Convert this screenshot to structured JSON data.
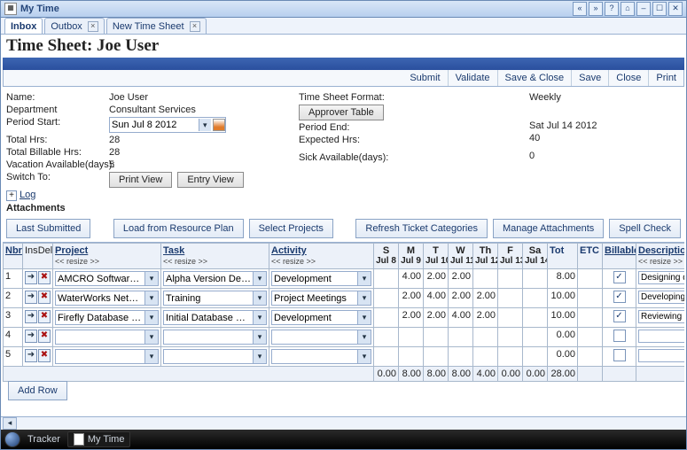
{
  "window": {
    "title": "My Time"
  },
  "winbuttons": [
    "«",
    "»",
    "?",
    "⌂",
    "–",
    "☐",
    "✕"
  ],
  "tabs": [
    {
      "label": "Inbox",
      "closable": false,
      "active": true
    },
    {
      "label": "Outbox",
      "closable": true,
      "active": false
    },
    {
      "label": "New Time Sheet",
      "closable": true,
      "active": false
    }
  ],
  "page_title": "Time Sheet: Joe User",
  "actions": [
    "Submit",
    "Validate",
    "Save & Close",
    "Save",
    "Close",
    "Print"
  ],
  "info": {
    "left": {
      "name_lbl": "Name:",
      "name_val": "Joe User",
      "dept_lbl": "Department",
      "dept_val": "Consultant Services",
      "pstart_lbl": "Period Start:",
      "pstart_val": "Sun Jul 8 2012",
      "thrs_lbl": "Total Hrs:",
      "thrs_val": "28",
      "tbhrs_lbl": "Total Billable Hrs:",
      "tbhrs_val": "28",
      "vac_lbl": "Vacation Available(days):",
      "vac_val": "5",
      "switch_lbl": "Switch To:",
      "log": "Log",
      "print_view": "Print View",
      "entry_view": "Entry View"
    },
    "mid": {
      "fmt_lbl": "Time Sheet Format:",
      "approver_btn": "Approver Table",
      "pend_lbl": "Period End:",
      "pend_val": "Sat Jul 14 2012",
      "exp_lbl": "Expected Hrs:",
      "exp_val": "40",
      "sick_lbl": "Sick Available(days):",
      "sick_val": "0"
    },
    "right": {
      "weekly": "Weekly"
    },
    "attachments": "Attachments"
  },
  "toolbar": [
    "Last Submitted",
    "Load from Resource Plan",
    "Select Projects",
    "Refresh Ticket Categories",
    "Manage Attachments",
    "Spell Check"
  ],
  "grid": {
    "nbr": "Nbr",
    "ins": "Ins",
    "del": "Del",
    "resize": "<< resize >>",
    "proj": "Project",
    "task": "Task",
    "act": "Activity",
    "days": [
      {
        "d": "S",
        "n": "Jul 8"
      },
      {
        "d": "M",
        "n": "Jul 9"
      },
      {
        "d": "T",
        "n": "Jul 10"
      },
      {
        "d": "W",
        "n": "Jul 11"
      },
      {
        "d": "Th",
        "n": "Jul 12"
      },
      {
        "d": "F",
        "n": "Jul 13"
      },
      {
        "d": "Sa",
        "n": "Jul 14"
      }
    ],
    "tot": "Tot",
    "etc": "ETC",
    "bill": "Billable",
    "desc": "Description"
  },
  "rows": [
    {
      "n": "1",
      "project": "AMCRO Software Project",
      "task": "Alpha Version Developme",
      "activity": "Development",
      "cells": [
        "",
        "4.00",
        "2.00",
        "2.00",
        "",
        "",
        ""
      ],
      "tot": "8.00",
      "etc": "",
      "bill": true,
      "desc": "Designing document"
    },
    {
      "n": "2",
      "project": "WaterWorks Network Up",
      "task": "Training",
      "activity": "Project Meetings",
      "cells": [
        "",
        "2.00",
        "4.00",
        "2.00",
        "2.00",
        "",
        ""
      ],
      "tot": "10.00",
      "etc": "",
      "bill": true,
      "desc": "Developing training material for preparation"
    },
    {
      "n": "3",
      "project": "Firefly Database Integratio",
      "task": "Initial Database Developm",
      "activity": "Development",
      "cells": [
        "",
        "2.00",
        "2.00",
        "4.00",
        "2.00",
        "",
        ""
      ],
      "tot": "10.00",
      "etc": "",
      "bill": true,
      "desc": "Reviewing database initial development"
    },
    {
      "n": "4",
      "project": "",
      "task": "",
      "activity": "",
      "cells": [
        "",
        "",
        "",
        "",
        "",
        "",
        ""
      ],
      "tot": "0.00",
      "etc": "",
      "bill": false,
      "desc": ""
    },
    {
      "n": "5",
      "project": "",
      "task": "",
      "activity": "",
      "cells": [
        "",
        "",
        "",
        "",
        "",
        "",
        ""
      ],
      "tot": "0.00",
      "etc": "",
      "bill": false,
      "desc": ""
    }
  ],
  "totals": {
    "cells": [
      "0.00",
      "8.00",
      "8.00",
      "8.00",
      "4.00",
      "0.00",
      "0.00"
    ],
    "tot": "28.00"
  },
  "add_row": "Add Row",
  "taskbar": {
    "tracker": "Tracker",
    "mytime": "My Time"
  }
}
